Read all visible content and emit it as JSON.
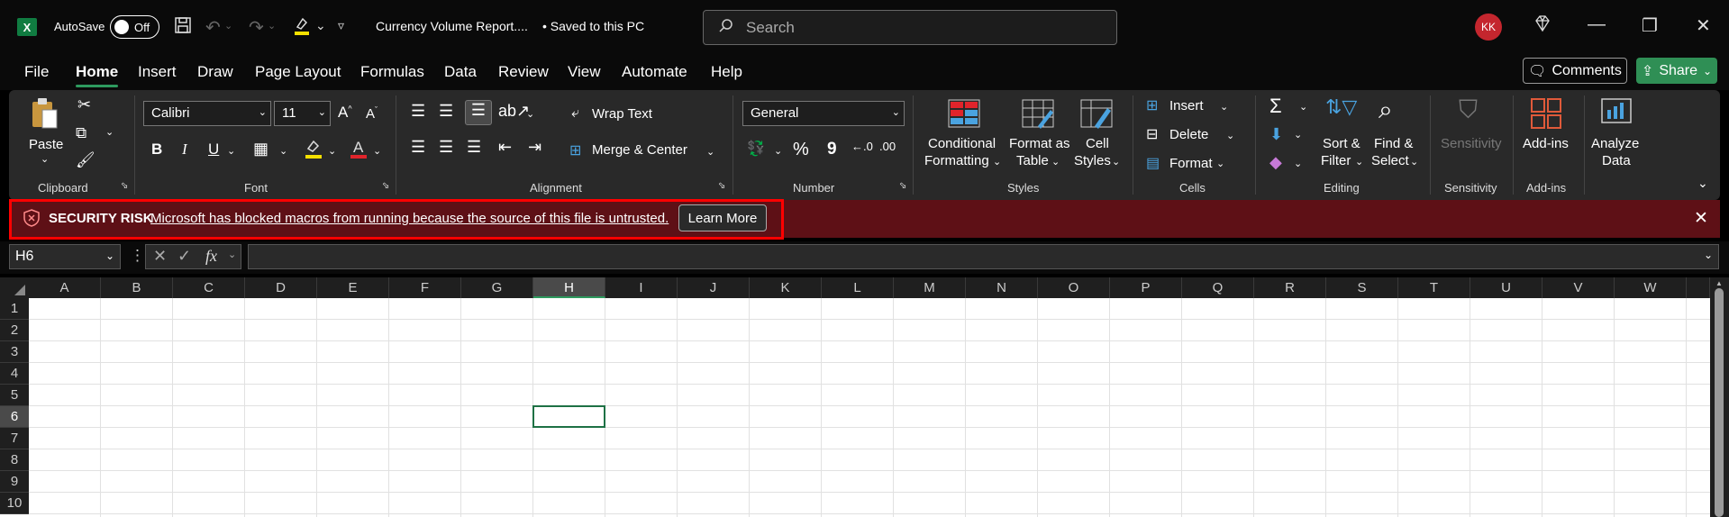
{
  "titlebar": {
    "app_icon": "X",
    "autosave_label": "AutoSave",
    "autosave_state": "Off",
    "filename": "Currency Volume Report....",
    "save_status": "• Saved to this PC",
    "search_placeholder": "Search",
    "user_initials": "KK"
  },
  "menu": {
    "items": [
      "File",
      "Home",
      "Insert",
      "Draw",
      "Page Layout",
      "Formulas",
      "Data",
      "Review",
      "View",
      "Automate",
      "Help"
    ],
    "active": "Home",
    "comments_label": "Comments",
    "share_label": "Share"
  },
  "ribbon": {
    "clipboard": {
      "paste": "Paste",
      "label": "Clipboard"
    },
    "font": {
      "name": "Calibri",
      "size": "11",
      "label": "Font",
      "bold": "B",
      "italic": "I",
      "underline": "U"
    },
    "alignment": {
      "wrap": "Wrap Text",
      "merge": "Merge & Center",
      "label": "Alignment"
    },
    "number": {
      "format": "General",
      "label": "Number",
      "percent": "%",
      "comma": "9"
    },
    "styles": {
      "conditional1": "Conditional",
      "conditional2": "Formatting",
      "format_table1": "Format as",
      "format_table2": "Table",
      "cell_styles1": "Cell",
      "cell_styles2": "Styles",
      "label": "Styles"
    },
    "cells": {
      "insert": "Insert",
      "delete": "Delete",
      "format": "Format",
      "label": "Cells"
    },
    "editing": {
      "sort1": "Sort &",
      "sort2": "Filter",
      "find1": "Find &",
      "find2": "Select",
      "label": "Editing"
    },
    "sensitivity": {
      "name": "Sensitivity",
      "label": "Sensitivity"
    },
    "addins": {
      "name": "Add-ins",
      "label": "Add-ins"
    },
    "analyze": {
      "line1": "Analyze",
      "line2": "Data"
    }
  },
  "alert": {
    "title": "SECURITY RISK",
    "message": "Microsoft has blocked macros from running because the source of this file is untrusted.",
    "button": "Learn More"
  },
  "formula_bar": {
    "cell_ref": "H6",
    "fx": "fx",
    "value": ""
  },
  "sheet": {
    "columns": [
      "A",
      "B",
      "C",
      "D",
      "E",
      "F",
      "G",
      "H",
      "I",
      "J",
      "K",
      "L",
      "M",
      "N",
      "O",
      "P",
      "Q",
      "R",
      "S",
      "T",
      "U",
      "V",
      "W"
    ],
    "rows": [
      "1",
      "2",
      "3",
      "4",
      "5",
      "6",
      "7",
      "8",
      "9",
      "10"
    ],
    "selected_col": "H",
    "selected_row": "6"
  },
  "colors": {
    "accent": "#2e9a5e",
    "alert_bg": "#5e1016",
    "alert_border": "#e00000",
    "excel_green": "#107c41"
  }
}
